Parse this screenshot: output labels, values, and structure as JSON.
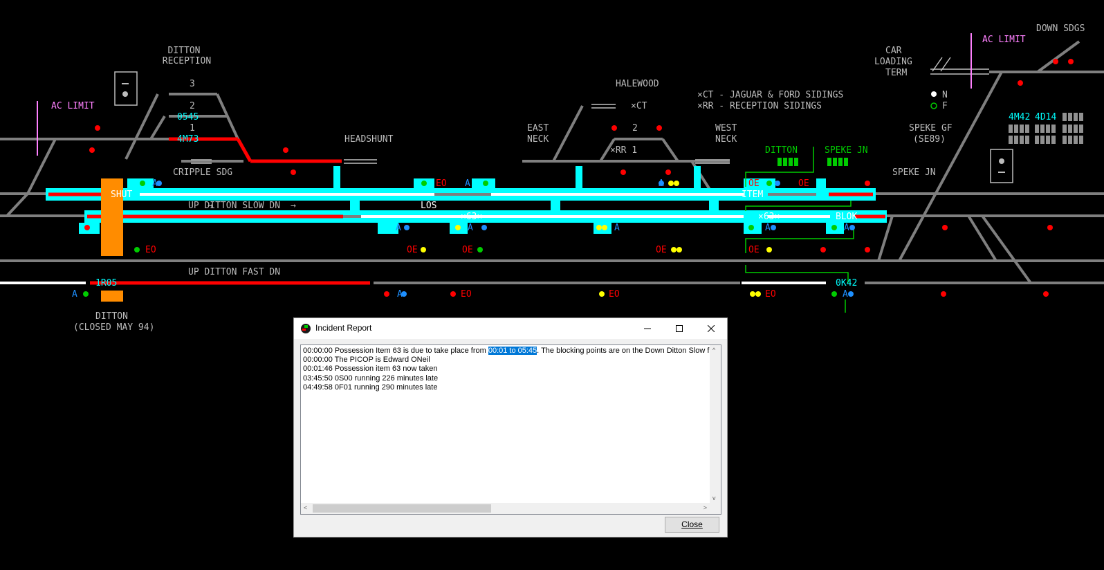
{
  "panel": {
    "labels": {
      "ditton_reception": [
        "DITTON",
        "RECEPTION"
      ],
      "cripple_sdg": "CRIPPLE SDG",
      "headshunt": "HEADSHUNT",
      "halewood": "HALEWOOD",
      "east_neck": [
        "EAST",
        "NECK"
      ],
      "west_neck": [
        "WEST",
        "NECK"
      ],
      "ct_note": "×CT - JAGUAR & FORD SIDINGS",
      "rr_note": "×RR - RECEPTION SIDINGS",
      "ct": "×CT",
      "rr1": "×RR 1",
      "two": "2",
      "car_loading": [
        "CAR",
        "LOADING",
        "TERM"
      ],
      "down_sdgs": "DOWN SDGS",
      "ac_limit": "AC LIMIT",
      "ac_limit_right": "AC LIMIT",
      "legend_n": "N",
      "legend_f": "F",
      "speke_gf": [
        "SPEKE GF",
        "(SE89)"
      ],
      "speke_jn": "SPEKE JN",
      "ditton_ctrl": "DITTON",
      "speke_jn_ctrl": "SPEKE JN",
      "up_ditton_slow": "UP DITTON SLOW DN",
      "up_ditton_fast": "UP DITTON FAST DN",
      "ditton_station": [
        "DITTON",
        "(CLOSED MAY 94)"
      ],
      "shut": "SHUT",
      "los": "LOS",
      "item": "ITEM",
      "blok": "BLOK",
      "x63_a": "×63×",
      "x63_b": "×63×",
      "road3": "3",
      "road2": "2",
      "road1": "1",
      "eo": "EO",
      "oe": "OE",
      "a": "A"
    },
    "train_ids": {
      "r2": "0545",
      "r1": "4M73",
      "fast_left": "1R05",
      "fast_right": "0K42",
      "top_right_1": "4M42",
      "top_right_2": "4D14"
    },
    "colors": {
      "track_grey": "#7f7f7f",
      "track_red": "#ff0000",
      "track_white": "#ffffff",
      "possession_cyan": "#00ffff",
      "signal_red": "#ff0000",
      "orange": "#ff8c00",
      "label_grey": "#bcbcbc",
      "control_green": "#00cc00",
      "ac_limit_pink": "#ff80ff"
    }
  },
  "dialog": {
    "title": "Incident Report",
    "log_lines": [
      {
        "pre": "00:00:00 Possession Item 63 is due to take place from ",
        "highlight": "00:01 to 05:45",
        "post": ". The blocking points are on the Down Ditton Slow from"
      },
      {
        "pre": "00:00:00 The PICOP is Edward ONeil",
        "highlight": "",
        "post": ""
      },
      {
        "pre": "00:01:46 Possession item 63 now taken",
        "highlight": "",
        "post": ""
      },
      {
        "pre": "03:45:50 0S00 running 226 minutes late",
        "highlight": "",
        "post": ""
      },
      {
        "pre": "04:49:58 0F01 running 290 minutes late",
        "highlight": "",
        "post": ""
      }
    ],
    "close_label": "Close",
    "arrow_left": "<",
    "arrow_right": ">",
    "arrow_up": "^",
    "arrow_down": "v"
  }
}
